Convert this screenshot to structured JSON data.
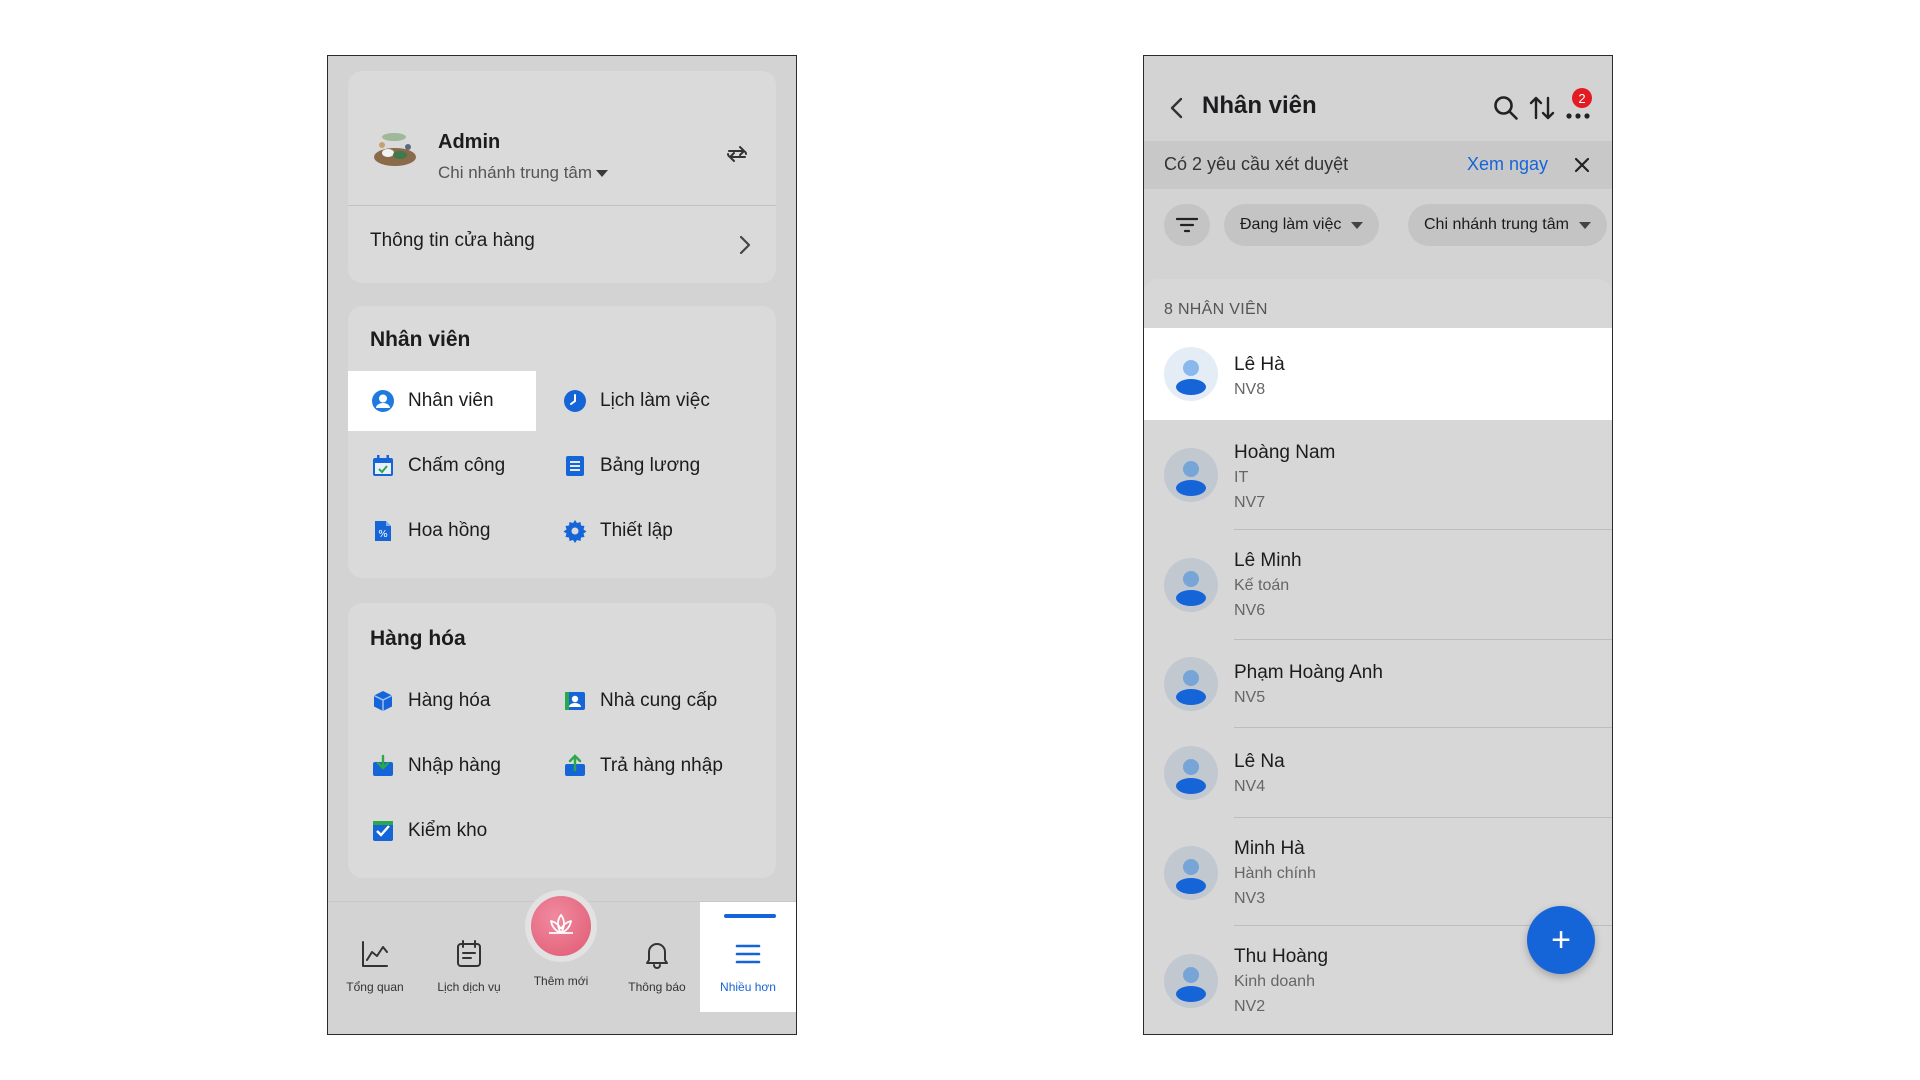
{
  "left": {
    "profile": {
      "name": "Admin",
      "branch": "Chi nhánh trung tâm",
      "store_info": "Thông tin cửa hàng"
    },
    "staff_section": {
      "title": "Nhân viên",
      "items": [
        {
          "label": "Nhân viên",
          "icon": "person-circle-icon"
        },
        {
          "label": "Lịch làm việc",
          "icon": "clock-icon"
        },
        {
          "label": "Chấm công",
          "icon": "calendar-check-icon"
        },
        {
          "label": "Bảng lương",
          "icon": "document-list-icon"
        },
        {
          "label": "Hoa hồng",
          "icon": "percent-document-icon"
        },
        {
          "label": "Thiết lập",
          "icon": "gear-icon"
        }
      ]
    },
    "goods_section": {
      "title": "Hàng hóa",
      "items": [
        {
          "label": "Hàng hóa",
          "icon": "box-icon"
        },
        {
          "label": "Nhà cung cấp",
          "icon": "supplier-card-icon"
        },
        {
          "label": "Nhập hàng",
          "icon": "import-icon"
        },
        {
          "label": "Trả hàng nhập",
          "icon": "export-icon"
        },
        {
          "label": "Kiểm kho",
          "icon": "checkbox-icon"
        }
      ]
    },
    "bottom_nav": [
      {
        "label": "Tổng quan",
        "icon": "chart-icon"
      },
      {
        "label": "Lịch dịch vụ",
        "icon": "calendar-icon"
      },
      {
        "label": "Thêm mới",
        "icon": "lotus-icon"
      },
      {
        "label": "Thông báo",
        "icon": "bell-icon"
      },
      {
        "label": "Nhiều hơn",
        "icon": "menu-icon"
      }
    ]
  },
  "right": {
    "title": "Nhân viên",
    "badge_count": "2",
    "approval": {
      "text": "Có 2 yêu cầu xét duyệt",
      "link": "Xem ngay"
    },
    "filters": {
      "status": "Đang làm việc",
      "branch": "Chi nhánh trung tâm"
    },
    "list_count": "8 NHÂN VIÊN",
    "employees": [
      {
        "name": "Lê Hà",
        "dept": "",
        "code": "NV8"
      },
      {
        "name": "Hoàng Nam",
        "dept": "IT",
        "code": "NV7"
      },
      {
        "name": "Lê Minh",
        "dept": "Kế toán",
        "code": "NV6"
      },
      {
        "name": "Phạm Hoàng Anh",
        "dept": "",
        "code": "NV5"
      },
      {
        "name": "Lê Na",
        "dept": "",
        "code": "NV4"
      },
      {
        "name": "Minh Hà",
        "dept": "Hành chính",
        "code": "NV3"
      },
      {
        "name": "Thu Hoàng",
        "dept": "Kinh doanh",
        "code": "NV2"
      }
    ],
    "fab_label": "+"
  },
  "colors": {
    "accent": "#1565d8",
    "badge": "#e31b23",
    "lotus": "#e05a72"
  }
}
